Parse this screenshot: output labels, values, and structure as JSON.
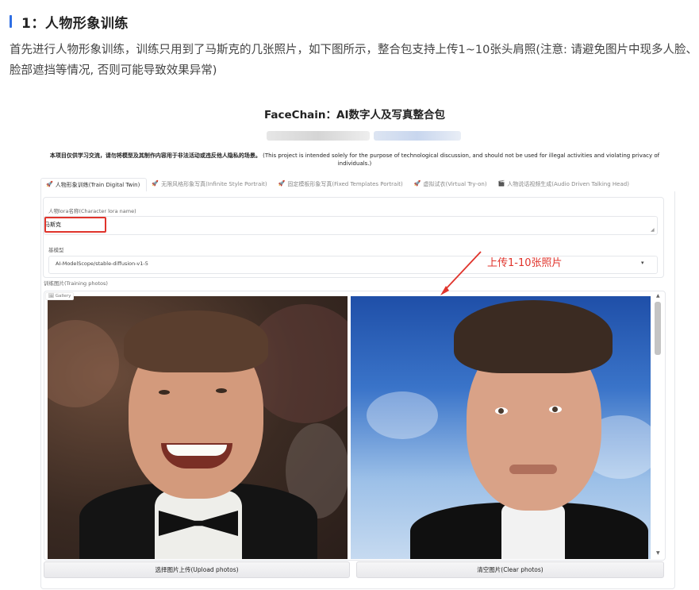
{
  "article": {
    "heading": "1：人物形象训练",
    "paragraph": "首先进行人物形象训练，训练只用到了马斯克的几张照片，如下图所示，整合包支持上传1~10张头肩照(注意: 请避免图片中现多人脸、脸部遮挡等情况, 否则可能导致效果异常)"
  },
  "app": {
    "title": "FaceChain：AI数字人及写真整合包",
    "disclaimer_cn": "本项目仅供学习交流，请勿将模型及其制作内容用于非法活动或违反他人隐私的场景。",
    "disclaimer_en": "(This project is intended solely for the purpose of technological discussion, and should not be used for illegal activities and violating privacy of individuals.)",
    "tabs": [
      {
        "label": "人物形象训练(Train Digital Twin)",
        "icon": "🚀",
        "active": true
      },
      {
        "label": "无限风格形象写真(Infinite Style Portrait)",
        "icon": "🚀",
        "active": false
      },
      {
        "label": "固定模板形象写真(Fixed Templates Portrait)",
        "icon": "🚀",
        "active": false
      },
      {
        "label": "虚拟试衣(Virtual Try-on)",
        "icon": "🚀",
        "active": false
      },
      {
        "label": "人物说话视频生成(Audio Driven Talking Head)",
        "icon": "🎬",
        "active": false
      }
    ],
    "form": {
      "lora_label": "人物lora名称(Character lora name)",
      "lora_value": "马斯克",
      "base_model_label": "基模型",
      "base_model_value": "AI-ModelScope/stable-diffusion-v1-5",
      "training_photos_label": "训练图片(Training photos)",
      "gallery_tag": "Gallery"
    },
    "buttons": {
      "upload": "选择图片上传(Upload photos)",
      "clear": "清空图片(Clear photos)"
    }
  },
  "annotation": {
    "text": "上传1-10张照片",
    "color": "#e0342c"
  },
  "colors": {
    "accent": "#2f6fe4",
    "highlight": "#e0342c"
  }
}
